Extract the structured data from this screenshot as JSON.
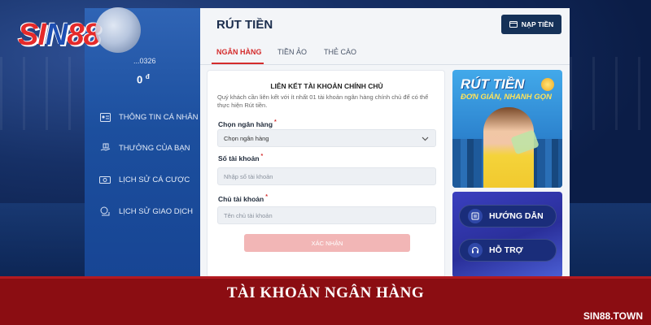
{
  "logo": {
    "text_red": "SI",
    "text_blue": "N",
    "text_red2": "88"
  },
  "sidebar": {
    "account_id": "...0326",
    "balance": "0",
    "balance_unit": "đ",
    "items": [
      {
        "label": "THÔNG TIN CÁ NHÂN",
        "icon": "id-card-icon"
      },
      {
        "label": "THƯỞNG CỦA BẠN",
        "icon": "gift-hand-icon"
      },
      {
        "label": "LỊCH SỬ CÁ CƯỢC",
        "icon": "ticket-icon"
      },
      {
        "label": "LỊCH SỬ GIAO DỊCH",
        "icon": "transaction-icon"
      }
    ]
  },
  "main": {
    "title": "RÚT TIỀN",
    "deposit_button": "NẠP TIỀN",
    "tabs": [
      {
        "label": "NGÂN HÀNG",
        "active": true
      },
      {
        "label": "TIỀN ẢO",
        "active": false
      },
      {
        "label": "THẺ CÀO",
        "active": false
      }
    ]
  },
  "form": {
    "title": "LIÊN KẾT TÀI KHOẢN CHÍNH CHỦ",
    "note": "Quý khách cần liên kết với ít nhất 01 tài khoản ngân hàng chính chủ để có thể thực hiện Rút tiền.",
    "bank": {
      "label": "Chọn ngân hàng",
      "value": "Chọn ngân hàng"
    },
    "account_number": {
      "label": "Số tài khoản",
      "placeholder": "Nhập số tài khoản"
    },
    "account_holder": {
      "label": "Chủ tài khoản",
      "placeholder": "Tên chủ tài khoản"
    },
    "required_mark": "*",
    "submit": "XÁC NHẬN"
  },
  "promo": {
    "title": "RÚT TIỀN",
    "subtitle": "ĐƠN GIẢN, NHANH GỌN"
  },
  "help": {
    "guide": "HƯỚNG DẪN",
    "support": "HỖ TRỢ"
  },
  "banner": {
    "title": "TÀI KHOẢN NGÂN HÀNG",
    "site": "SIN88.TOWN"
  },
  "colors": {
    "accent_red": "#d42c2c",
    "sidebar_blue": "#1c4f9e",
    "banner_red": "#8b0d12",
    "dark_button": "#153158"
  }
}
